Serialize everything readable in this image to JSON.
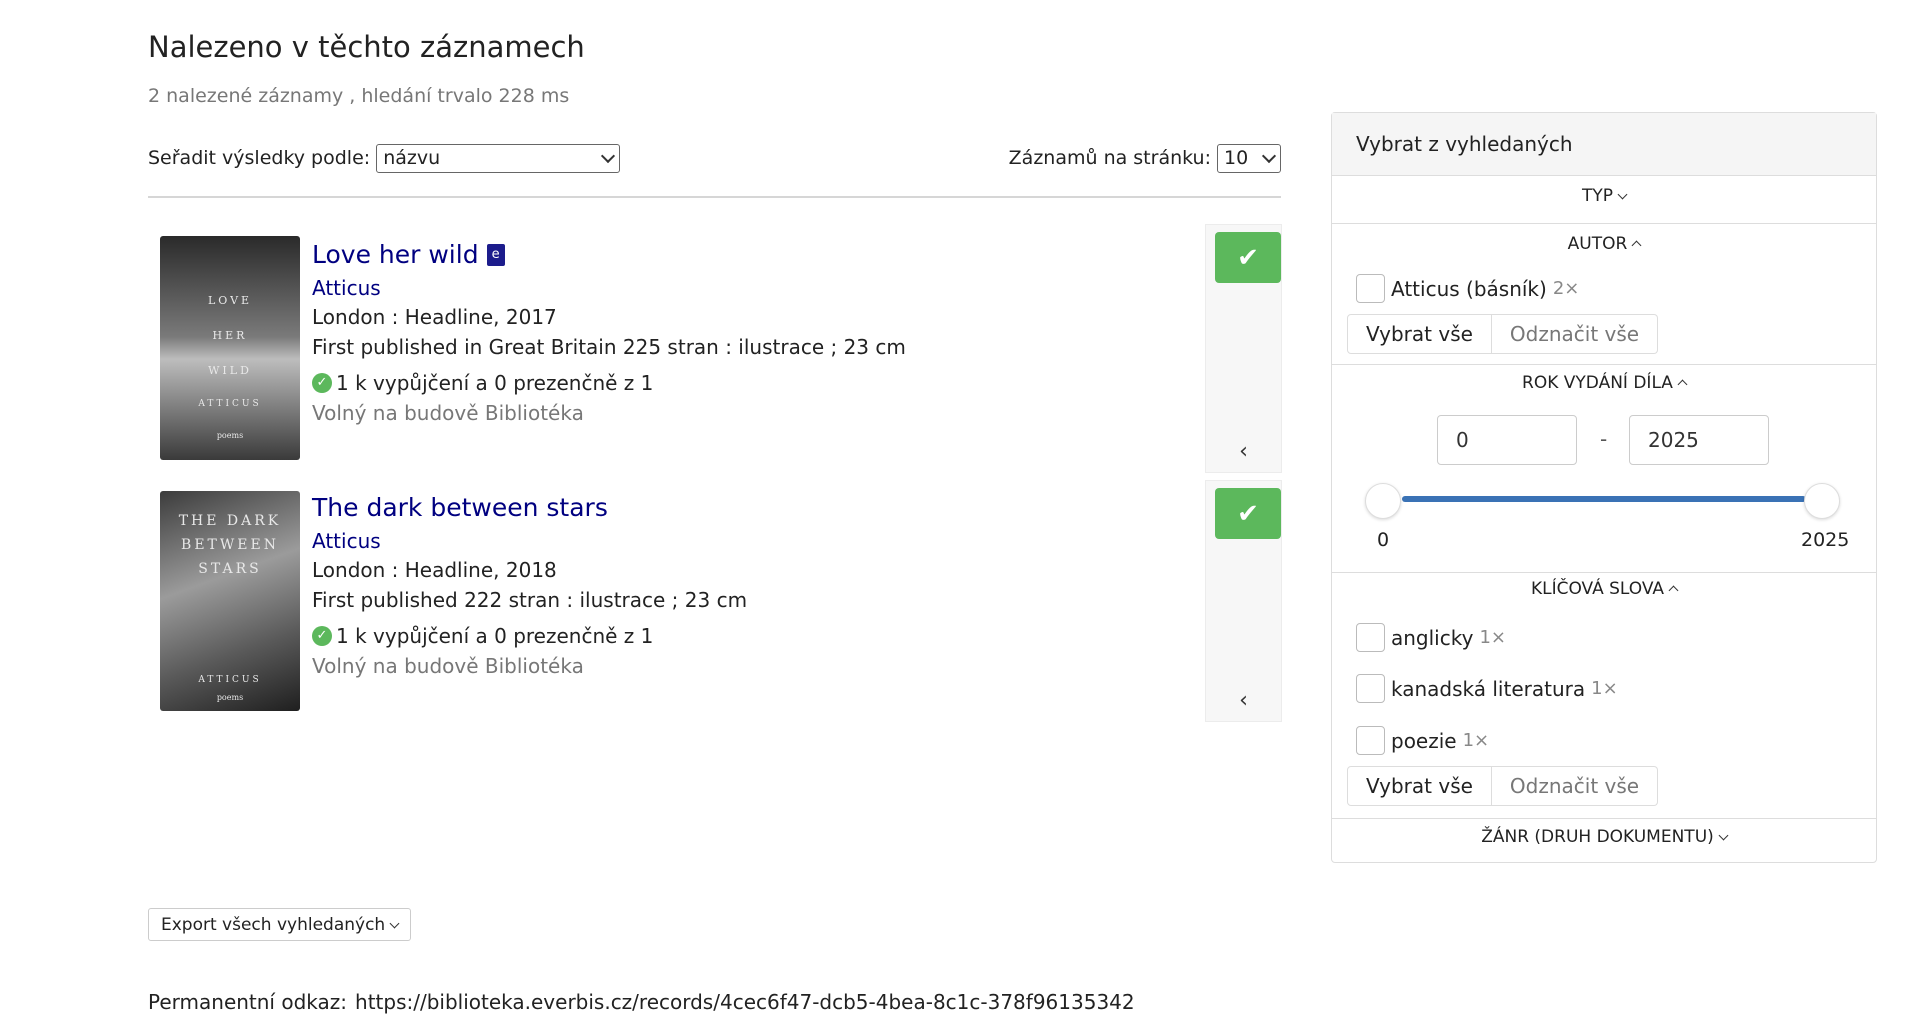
{
  "heading": "Nalezeno v těchto záznamech",
  "summary": "2 nalezené záznamy , hledání trvalo 228 ms",
  "sort": {
    "label": "Seřadit výsledky podle:",
    "value": "názvu",
    "per_page_label": "Záznamů na stránku:",
    "per_page_value": "10"
  },
  "records": [
    {
      "cover_lines": [
        "LOVE",
        "HER",
        "WILD",
        "ATTICUS",
        "poems"
      ],
      "title": "Love her wild",
      "ebook_icon": "e",
      "author": "Atticus",
      "imprint": "London : Headline, 2017",
      "description": "First published in Great Britain 225 stran : ilustrace ; 23 cm",
      "availability": "1 k vypůjčení a 0 prezenčně z 1",
      "location": "Volný na budově Bibliotéka"
    },
    {
      "cover_lines": [
        "THE DARK",
        "BETWEEN",
        "STARS",
        "ATTICUS",
        "poems"
      ],
      "title": "The dark between stars",
      "author": "Atticus",
      "imprint": "London : Headline, 2018",
      "description": "First published 222 stran : ilustrace ; 23 cm",
      "availability": "1 k vypůjčení a 0 prezenčně z 1",
      "location": "Volný na budově Bibliotéka"
    }
  ],
  "export_label": "Export všech vyhledaných",
  "permalink": {
    "label": "Permanentní odkaz:",
    "url": "https://biblioteka.everbis.cz/records/4cec6f47-dcb5-4bea-8c1c-378f96135342"
  },
  "facets": {
    "title": "Vybrat z vyhledaných",
    "typ": "TYP",
    "autor": {
      "title": "AUTOR",
      "items": [
        {
          "label": "Atticus (básník)",
          "count": "2×"
        }
      ],
      "select_all": "Vybrat vše",
      "deselect_all": "Odznačit vše"
    },
    "rok": {
      "title": "ROK VYDÁNÍ DÍLA",
      "from": "0",
      "dash": "-",
      "to": "2025",
      "min_label": "0",
      "max_label": "2025",
      "range_fraction": [
        0,
        1
      ]
    },
    "klicova": {
      "title": "KLÍČOVÁ SLOVA",
      "items": [
        {
          "label": "anglicky",
          "count": "1×"
        },
        {
          "label": "kanadská literatura",
          "count": "1×"
        },
        {
          "label": "poezie",
          "count": "1×"
        }
      ],
      "select_all": "Vybrat vše",
      "deselect_all": "Odznačit vše"
    },
    "zanr": "ŽÁNR (DRUH DOKUMENTU)"
  },
  "icons": {
    "check": "✔",
    "collapse": "‹",
    "ok": "✓"
  },
  "colors": {
    "link": "#000080",
    "success": "#5cb85c",
    "slider": "#3a72b5"
  }
}
